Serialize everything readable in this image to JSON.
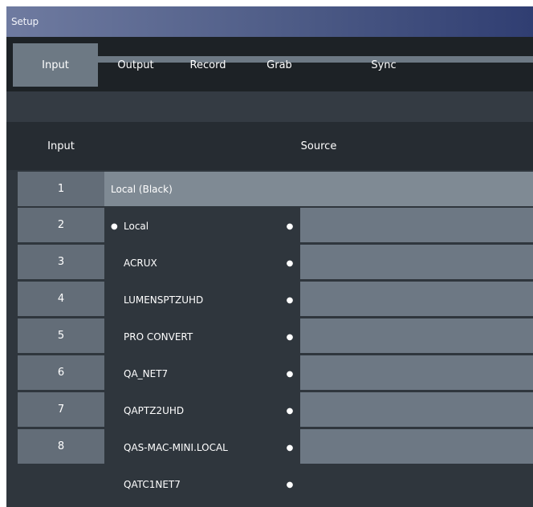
{
  "window": {
    "title": "Setup"
  },
  "tabs": [
    {
      "label": "Input",
      "active": true
    },
    {
      "label": "Output",
      "active": false
    },
    {
      "label": "Record",
      "active": false
    },
    {
      "label": "Grab",
      "active": false
    },
    {
      "label": "Sync",
      "active": false
    }
  ],
  "table": {
    "col_input": "Input",
    "col_source": "Source",
    "rows": [
      "1",
      "2",
      "3",
      "4",
      "5",
      "6",
      "7",
      "8"
    ],
    "selected_source": "Local (Black)"
  },
  "dropdown": {
    "items": [
      {
        "label": "Local",
        "checked": true,
        "check_icon": "bullet-check-icon",
        "submenu_icon": "submenu-dot-icon"
      },
      {
        "label": "ACRUX",
        "checked": false,
        "submenu_icon": "submenu-dot-icon"
      },
      {
        "label": "LUMENSPTZUHD",
        "checked": false,
        "submenu_icon": "submenu-dot-icon"
      },
      {
        "label": "PRO CONVERT",
        "checked": false,
        "submenu_icon": "submenu-dot-icon"
      },
      {
        "label": "QA_NET7",
        "checked": false,
        "submenu_icon": "submenu-dot-icon"
      },
      {
        "label": "QAPTZ2UHD",
        "checked": false,
        "submenu_icon": "submenu-dot-icon"
      },
      {
        "label": "QAS-MAC-MINI.LOCAL",
        "checked": false,
        "submenu_icon": "submenu-dot-icon"
      },
      {
        "label": "QATC1NET7",
        "checked": false,
        "submenu_icon": "submenu-dot-icon"
      }
    ]
  },
  "colors": {
    "titlebar_start": "#6f7ba0",
    "titlebar_end": "#303e72",
    "active_tab": "#6d7984",
    "row_number": "#636d78",
    "row_source": "#6d7884",
    "row_selected": "#7f8a94",
    "dropdown_bg": "#2f363d"
  }
}
